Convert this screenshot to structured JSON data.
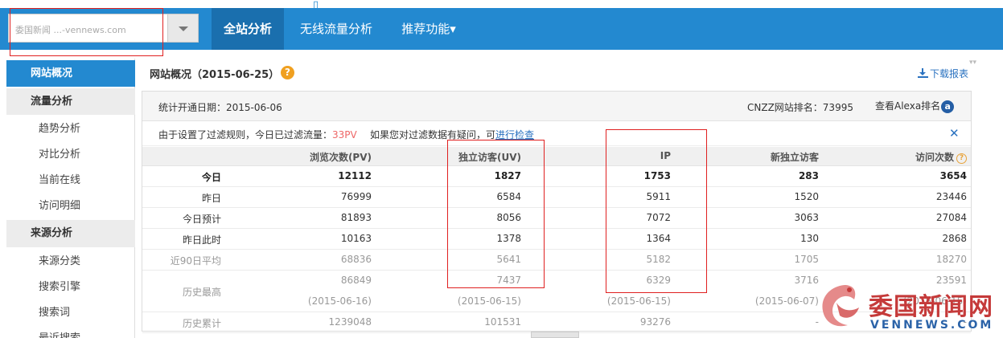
{
  "topbar": {
    "site_selector_value": "委国新闻 ...-vennews.com",
    "tabs": [
      {
        "label": "全站分析",
        "active": true
      },
      {
        "label": "无线流量分析",
        "active": false
      },
      {
        "label": "推荐功能▾",
        "active": false
      }
    ]
  },
  "sidebar": {
    "items": [
      {
        "label": "网站概况",
        "kind": "active"
      },
      {
        "label": "流量分析",
        "kind": "group"
      },
      {
        "label": "趋势分析",
        "kind": "sub"
      },
      {
        "label": "对比分析",
        "kind": "sub"
      },
      {
        "label": "当前在线",
        "kind": "sub"
      },
      {
        "label": "访问明细",
        "kind": "sub"
      },
      {
        "label": "来源分析",
        "kind": "group"
      },
      {
        "label": "来源分类",
        "kind": "sub"
      },
      {
        "label": "搜索引擎",
        "kind": "sub"
      },
      {
        "label": "搜索词",
        "kind": "sub"
      },
      {
        "label": "最近搜索",
        "kind": "sub"
      }
    ]
  },
  "main": {
    "title": "网站概况（2015-06-25）",
    "help_icon": "?",
    "download_label": "下载报表",
    "stats_start_label": "统计开通日期：2015-06-06",
    "cnzz_rank_label": "CNZZ网站排名：73995",
    "alexa_label": "查看Alexa排名",
    "alexa_icon": "a",
    "filter_text_prefix": "由于设置了过滤规则，今日已过滤流量：",
    "filter_pv": "33PV",
    "filter_text_question": "如果您对过滤数据有疑问，可",
    "filter_link": "进行检查",
    "close_icon": "✕"
  },
  "table": {
    "headers": [
      "浏览次数(PV)",
      "独立访客(UV)",
      "IP",
      "新独立访客",
      "访问次数"
    ],
    "visits_hint_icon": "?",
    "rows": [
      {
        "label": "今日",
        "values": [
          "12112",
          "1827",
          "1753",
          "283",
          "3654"
        ],
        "style": "bold"
      },
      {
        "label": "昨日",
        "values": [
          "76999",
          "6584",
          "5911",
          "1520",
          "23446"
        ],
        "style": "normal"
      },
      {
        "label": "今日预计",
        "values": [
          "81893",
          "8056",
          "7072",
          "3063",
          "27084"
        ],
        "style": "normal"
      },
      {
        "label": "昨日此时",
        "values": [
          "10163",
          "1378",
          "1364",
          "130",
          "2868"
        ],
        "style": "normal"
      },
      {
        "label": "近90日平均",
        "values": [
          "68836",
          "5641",
          "5182",
          "1705",
          "18270"
        ],
        "style": "grey"
      },
      {
        "label": "历史最高",
        "values": [
          "86849",
          "7437",
          "6329",
          "3716",
          "23591"
        ],
        "dates": [
          "(2015-06-16)",
          "(2015-06-15)",
          "(2015-06-15)",
          "(2015-06-07)",
          "(2015-06-15)"
        ],
        "style": "grey"
      },
      {
        "label": "历史累计",
        "values": [
          "1239048",
          "101531",
          "93276",
          "-",
          "-"
        ],
        "style": "grey"
      }
    ]
  },
  "watermark": {
    "cn": "委国新闻网",
    "en": "VENNEWS.COM"
  }
}
